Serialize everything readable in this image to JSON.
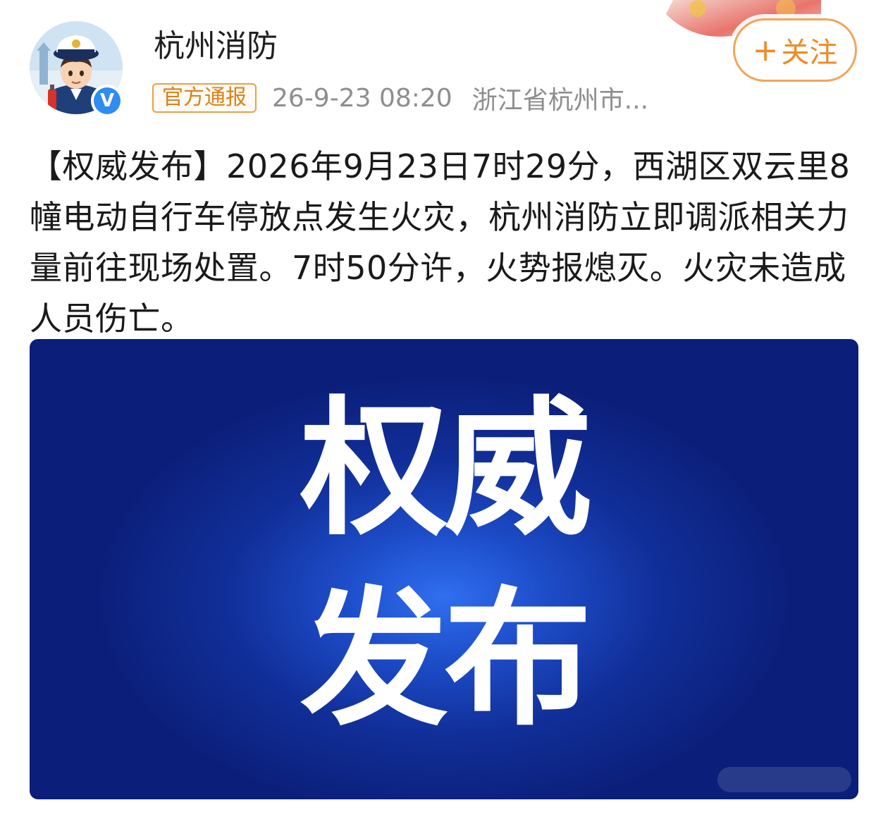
{
  "header": {
    "account_name": "杭州消防",
    "official_tag": "官方通报",
    "timestamp": "26-9-23 08:20",
    "location": "浙江省杭州市...",
    "follow_plus": "+",
    "follow_label": "关注",
    "verified_mark": "V"
  },
  "post": {
    "text": "【权威发布】2026年9月23日7时29分，西湖区双云里8幢电动自行车停放点发生火灾，杭州消防立即调派相关力量前往现场处置。7时50分许，火势报熄灭。火灾未造成人员伤亡。"
  },
  "image": {
    "banner_line_1": "权威",
    "banner_line_2": "发布"
  },
  "colors": {
    "follow_accent": "#f08a24",
    "tag_accent": "#d7831f",
    "banner_blue": "#1d4cc8",
    "verified_blue": "#2f8cf0"
  }
}
